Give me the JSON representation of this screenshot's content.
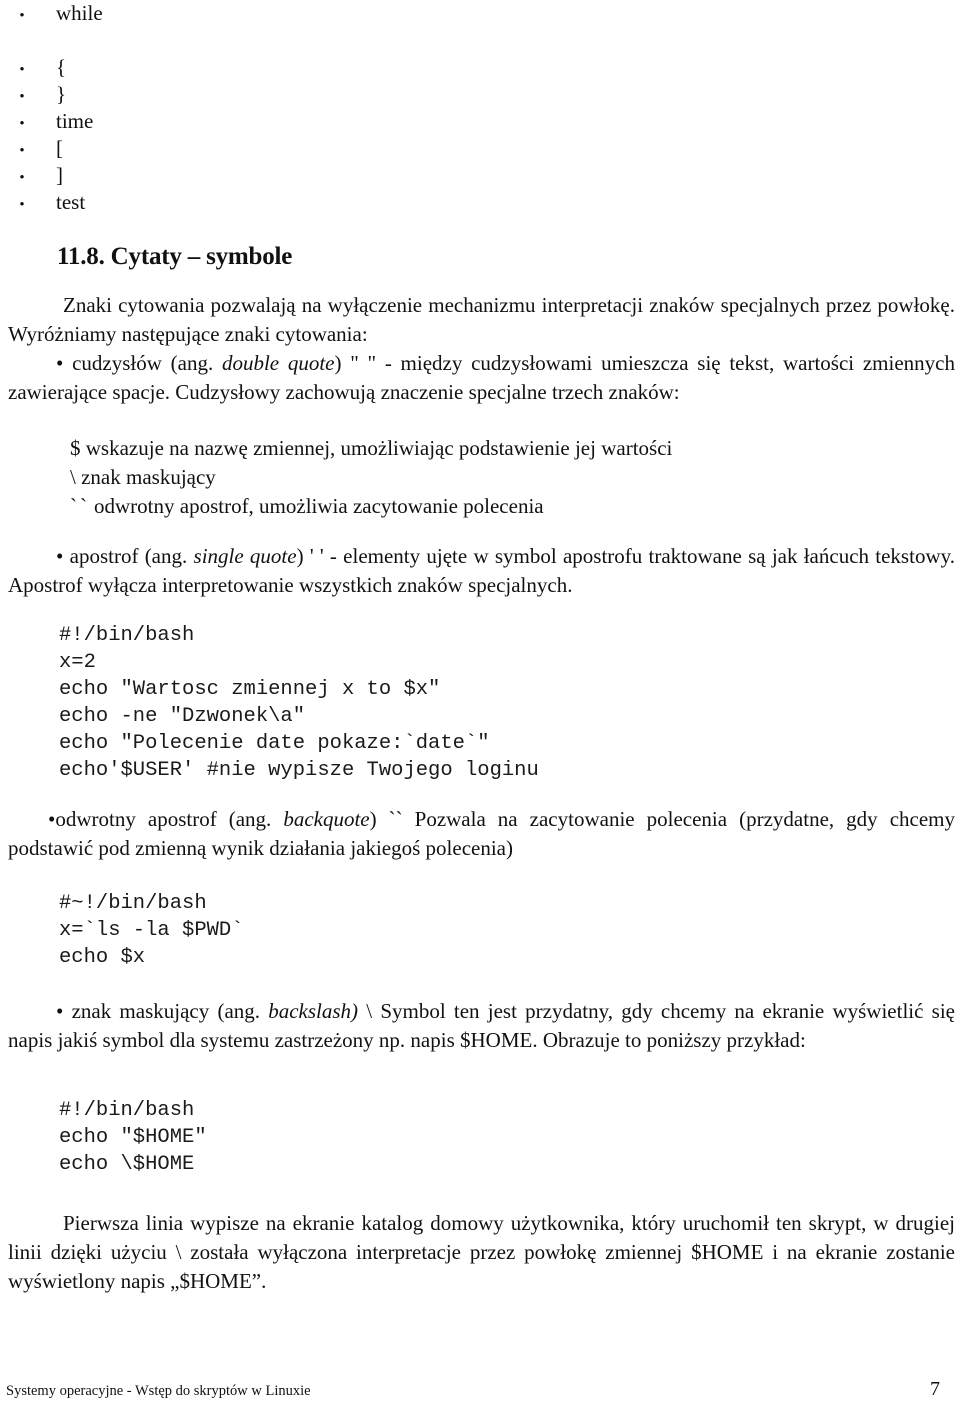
{
  "document": {
    "language": "pl",
    "page_background": "#ffffff",
    "text_color": "#111111"
  },
  "keyword_list": {
    "items": [
      {
        "bullet": "•",
        "label": "while",
        "gap_after": true
      },
      {
        "bullet": "•",
        "label": "{",
        "gap_after": false
      },
      {
        "bullet": "•",
        "label": "}",
        "gap_after": false
      },
      {
        "bullet": "•",
        "label": "time",
        "gap_after": false
      },
      {
        "bullet": "•",
        "label": "[",
        "gap_after": false
      },
      {
        "bullet": "•",
        "label": "]",
        "gap_after": false
      },
      {
        "bullet": "•",
        "label": "test",
        "gap_after": false
      }
    ]
  },
  "heading": {
    "number": "11.8.",
    "title": "Cytaty – symbole",
    "full": "11.8. Cytaty – symbole"
  },
  "intro": {
    "paragraph": "Znaki cytowania pozwalają na wyłączenie mechanizmu interpretacji znaków specjalnych przez powłokę. Wyróżniamy następujące znaki cytowania:"
  },
  "double_quote_item": {
    "bullet": "•",
    "lead": "cudzysłów (ang. ",
    "term": "double quote",
    "rest": ") \" \" - między cudzysłowami umieszcza się tekst, wartości zmiennych zawierające spacje. Cudzysłowy zachowują znaczenie specjalne trzech znaków:"
  },
  "symbol_list": {
    "lines": [
      {
        "symbol": "$",
        "text": " wskazuje na nazwę zmiennej, umożliwiając podstawienie jej wartości"
      },
      {
        "symbol": "\\",
        "text": " znak maskujący"
      },
      {
        "symbol": "``",
        "text": "odwrotny apostrof, umożliwia zacytowanie polecenia"
      }
    ]
  },
  "single_quote_item": {
    "bullet": "•",
    "lead": "apostrof (ang. ",
    "term": "single quote",
    "rest": ") ' ' - elementy ujęte w symbol apostrofu traktowane są jak łańcuch tekstowy. Apostrof wyłącza interpretowanie wszystkich znaków specjalnych."
  },
  "code_block_1": {
    "language": "bash",
    "content": "#!/bin/bash\nx=2\necho \"Wartosc zmiennej x to $x\"\necho -ne \"Dzwonek\\a\"\necho \"Polecenie date pokaze:`date`\"\necho'$USER' #nie wypisze Twojego loginu"
  },
  "backquote_item": {
    "bullet": "•",
    "lead": "odwrotny apostrof (ang. ",
    "term": "backquote",
    "rest": ") `` Pozwala na zacytowanie polecenia (przydatne, gdy chcemy podstawić pod zmienną wynik działania jakiegoś polecenia)"
  },
  "code_block_2": {
    "language": "bash",
    "content": "#~!/bin/bash\nx=`ls -la $PWD`\necho $x"
  },
  "backslash_item": {
    "bullet": "•",
    "lead": " znak maskujący (ang. ",
    "term": "backslash)",
    "rest": " \\ Symbol ten jest przydatny, gdy chcemy na ekranie wyświetlić się napis jakiś symbol dla systemu zastrzeżony np. napis $HOME. Obrazuje to poniższy przykład:"
  },
  "code_block_3": {
    "language": "bash",
    "content": "#!/bin/bash\necho \"$HOME\"\necho \\$HOME"
  },
  "closing": {
    "paragraph": "Pierwsza linia wypisze na ekranie katalog domowy użytkownika, który uruchomił ten skrypt, w drugiej linii dzięki użyciu \\ została wyłączona interpretacje przez powłokę zmiennej $HOME i na ekranie zostanie wyświetlony napis „$HOME”."
  },
  "footer": {
    "left_text": "Systemy operacyjne - Wstęp do skryptów w Linuxie",
    "page_number": "7"
  }
}
